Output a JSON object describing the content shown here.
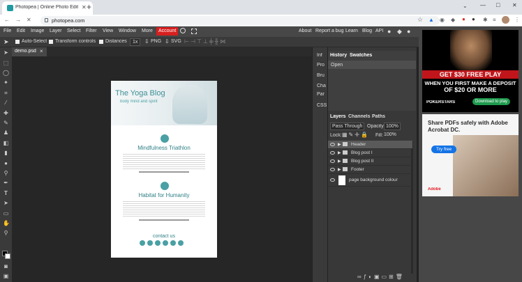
{
  "browser": {
    "tab_title": "Photopea | Online Photo Editor",
    "new_tab": "+",
    "url": "photopea.com",
    "window_controls": [
      "—",
      "□",
      "✕"
    ]
  },
  "menubar": {
    "items": [
      "File",
      "Edit",
      "Image",
      "Layer",
      "Select",
      "Filter",
      "View",
      "Window",
      "More"
    ],
    "account": "Account",
    "right_items": [
      "About",
      "Report a bug",
      "Learn",
      "Blog",
      "API"
    ]
  },
  "options": {
    "auto_select": "Auto-Select",
    "transform_controls": "Transform controls",
    "distances": "Distances",
    "zoom": "1x",
    "png": "PNG",
    "svg": "SVG"
  },
  "document_tab": {
    "name": "demo.psd",
    "close": "×"
  },
  "collapsed_panels": [
    "Inf",
    "Pro",
    "Bru",
    "Cha",
    "Par",
    "CSS"
  ],
  "history_panel": {
    "tabs": [
      "History",
      "Swatches"
    ],
    "items": [
      "Open"
    ]
  },
  "layers_panel": {
    "tabs": [
      "Layers",
      "Channels",
      "Paths"
    ],
    "blend_mode": "Pass Through",
    "opacity_label": "Opacity:",
    "opacity_value": "100%",
    "lock_label": "Lock:",
    "fill_label": "Fill:",
    "fill_value": "100%",
    "layers": [
      "Header",
      "Blog post I",
      "Blog post II",
      "Footer",
      "page background colour"
    ]
  },
  "doc_content": {
    "blog_title": "The Yoga Blog",
    "blog_subtitle": "body mind and spirit",
    "post1_title": "Mindfulness Triathlon",
    "post2_title": "Habitat for Humanity",
    "contact": "contact us"
  },
  "ad1": {
    "line1": "GET $30 FREE PLAY",
    "line2": "WHEN YOU FIRST MAKE A DEPOSIT",
    "line3": "OF $20 OR MORE",
    "brand": "POKERSTARS",
    "cta": "Download to play"
  },
  "ad2": {
    "headline": "Share PDFs safely with Adobe Acrobat DC.",
    "cta": "Try free",
    "brand": "Adobe"
  },
  "colors": {
    "account_red": "#d71f1f",
    "doc_teal": "#4aa0a4",
    "ad1_red": "#c0161b",
    "ad2_blue": "#1473e6"
  }
}
